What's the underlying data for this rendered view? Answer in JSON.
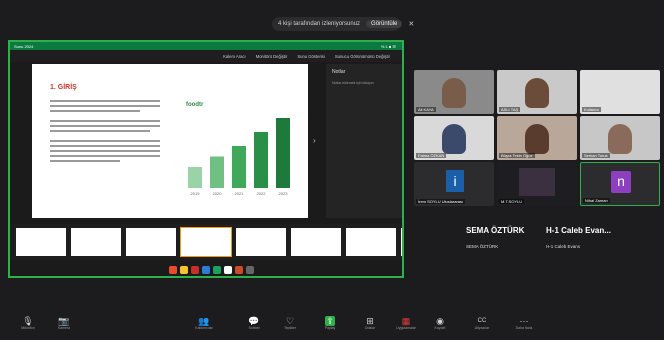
{
  "banner": {
    "text": "4 kişi tarafından izleniyorsunuz",
    "stop_label": "Görüntüle",
    "close_glyph": "✕"
  },
  "ppt": {
    "topbar_left": "Sunu 2024",
    "topbar_right": "% 1 ■ ☰",
    "toolbar": [
      "Kalem Aracı",
      "Monitörü Değiştir",
      "Sunu Gösterisi",
      "Sunucu Görünümünü Değiştir"
    ],
    "slide_title": "1. GİRİŞ",
    "slide_logo": "foodtr",
    "chart_data": {
      "type": "bar",
      "categories": [
        "2019",
        "2020",
        "2021",
        "2022",
        "2023"
      ],
      "values": [
        30,
        45,
        60,
        80,
        100
      ],
      "title": "",
      "xlabel": "",
      "ylabel": ""
    },
    "notes_title": "Notlar",
    "notes_hint": "Notlar eklemek için tıklayın",
    "thumb_count": 8
  },
  "participants": [
    {
      "name": "Ali KAYA"
    },
    {
      "name": "ASLI TAŞ"
    },
    {
      "name": "Kullanıcı"
    },
    {
      "name": "Fatma ÖZKAN"
    },
    {
      "name": "Büşra Tekin Oğuz"
    },
    {
      "name": "Serkan Tutuk"
    },
    {
      "name": "İrem SOYLU Uluslararası"
    },
    {
      "name": "M.T.SOYLU"
    },
    {
      "name": "Nihal Zaman"
    }
  ],
  "speakers": [
    {
      "name": "SEMA ÖZTÜRK",
      "sub": "SEMA ÖZTÜRK"
    },
    {
      "name": "H-1 Caleb Evan...",
      "sub": "H-1 Caleb Evans"
    }
  ],
  "toolbar": [
    {
      "icon": "microphone-icon",
      "glyph": "🎙",
      "label": "Mikrofon"
    },
    {
      "icon": "camera-icon",
      "glyph": "📷",
      "label": "Kamera"
    },
    {
      "icon": "participants-icon",
      "glyph": "👥",
      "label": "Katılımcılar"
    },
    {
      "icon": "chat-icon",
      "glyph": "💬",
      "label": "Sohbet"
    },
    {
      "icon": "reactions-icon",
      "glyph": "♡",
      "label": "Tepkiler"
    },
    {
      "icon": "share-icon",
      "glyph": "⇪",
      "label": "Paylaş"
    },
    {
      "icon": "rooms-icon",
      "glyph": "⊞",
      "label": "Odalar"
    },
    {
      "icon": "apps-icon",
      "glyph": "▦",
      "label": "Uygulamalar"
    },
    {
      "icon": "record-icon",
      "glyph": "◉",
      "label": "Kaydet"
    },
    {
      "icon": "captions-icon",
      "glyph": "CC",
      "label": "Altyazılar"
    },
    {
      "icon": "more-icon",
      "glyph": "⋯",
      "label": "Daha fazla"
    }
  ]
}
